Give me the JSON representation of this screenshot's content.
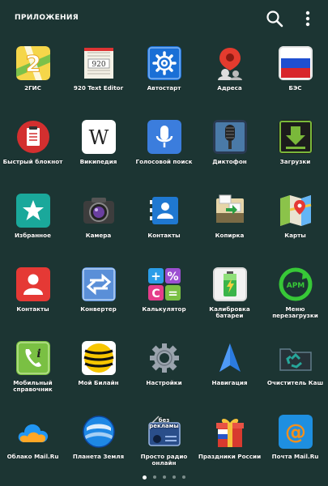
{
  "header": {
    "title": "ПРИЛОЖЕНИЯ"
  },
  "apps": [
    {
      "label": "2ГИС",
      "icon": "2gis-icon"
    },
    {
      "label": "920 Text Editor",
      "icon": "text-editor-icon"
    },
    {
      "label": "Автостарт",
      "icon": "gear-icon"
    },
    {
      "label": "Адреса",
      "icon": "map-pin-icon"
    },
    {
      "label": "БЭС",
      "icon": "russian-flag-icon"
    },
    {
      "label": "Быстрый блокнот",
      "icon": "notepad-icon"
    },
    {
      "label": "Википедия",
      "icon": "wikipedia-icon"
    },
    {
      "label": "Голосовой поиск",
      "icon": "microphone-icon"
    },
    {
      "label": "Диктофон",
      "icon": "dictaphone-icon"
    },
    {
      "label": "Загрузки",
      "icon": "download-icon"
    },
    {
      "label": "Избранное",
      "icon": "star-icon"
    },
    {
      "label": "Камера",
      "icon": "camera-icon"
    },
    {
      "label": "Контакты",
      "icon": "contacts-icon"
    },
    {
      "label": "Копирка",
      "icon": "copier-icon"
    },
    {
      "label": "Карты",
      "icon": "maps-icon"
    },
    {
      "label": "Контакты",
      "icon": "person-icon"
    },
    {
      "label": "Конвертер",
      "icon": "converter-icon"
    },
    {
      "label": "Калькулятор",
      "icon": "calculator-icon"
    },
    {
      "label": "Калибровка батареи",
      "icon": "battery-icon"
    },
    {
      "label": "Меню перезагрузки",
      "icon": "reboot-icon"
    },
    {
      "label": "Мобильный справочник",
      "icon": "phone-book-icon"
    },
    {
      "label": "Мой Билайн",
      "icon": "beeline-icon"
    },
    {
      "label": "Настройки",
      "icon": "settings-icon"
    },
    {
      "label": "Навигация",
      "icon": "navigation-icon"
    },
    {
      "label": "Очиститель Каш",
      "icon": "cache-cleaner-icon"
    },
    {
      "label": "Облако Mail.Ru",
      "icon": "cloud-icon"
    },
    {
      "label": "Планета Земля",
      "icon": "earth-icon"
    },
    {
      "label": "Просто радио онлайн",
      "icon": "radio-icon",
      "badge": "без рекламы"
    },
    {
      "label": "Праздники России",
      "icon": "gift-icon"
    },
    {
      "label": "Почта Mail.Ru",
      "icon": "mail-icon"
    }
  ],
  "pager": {
    "count": 5,
    "active": 0
  }
}
